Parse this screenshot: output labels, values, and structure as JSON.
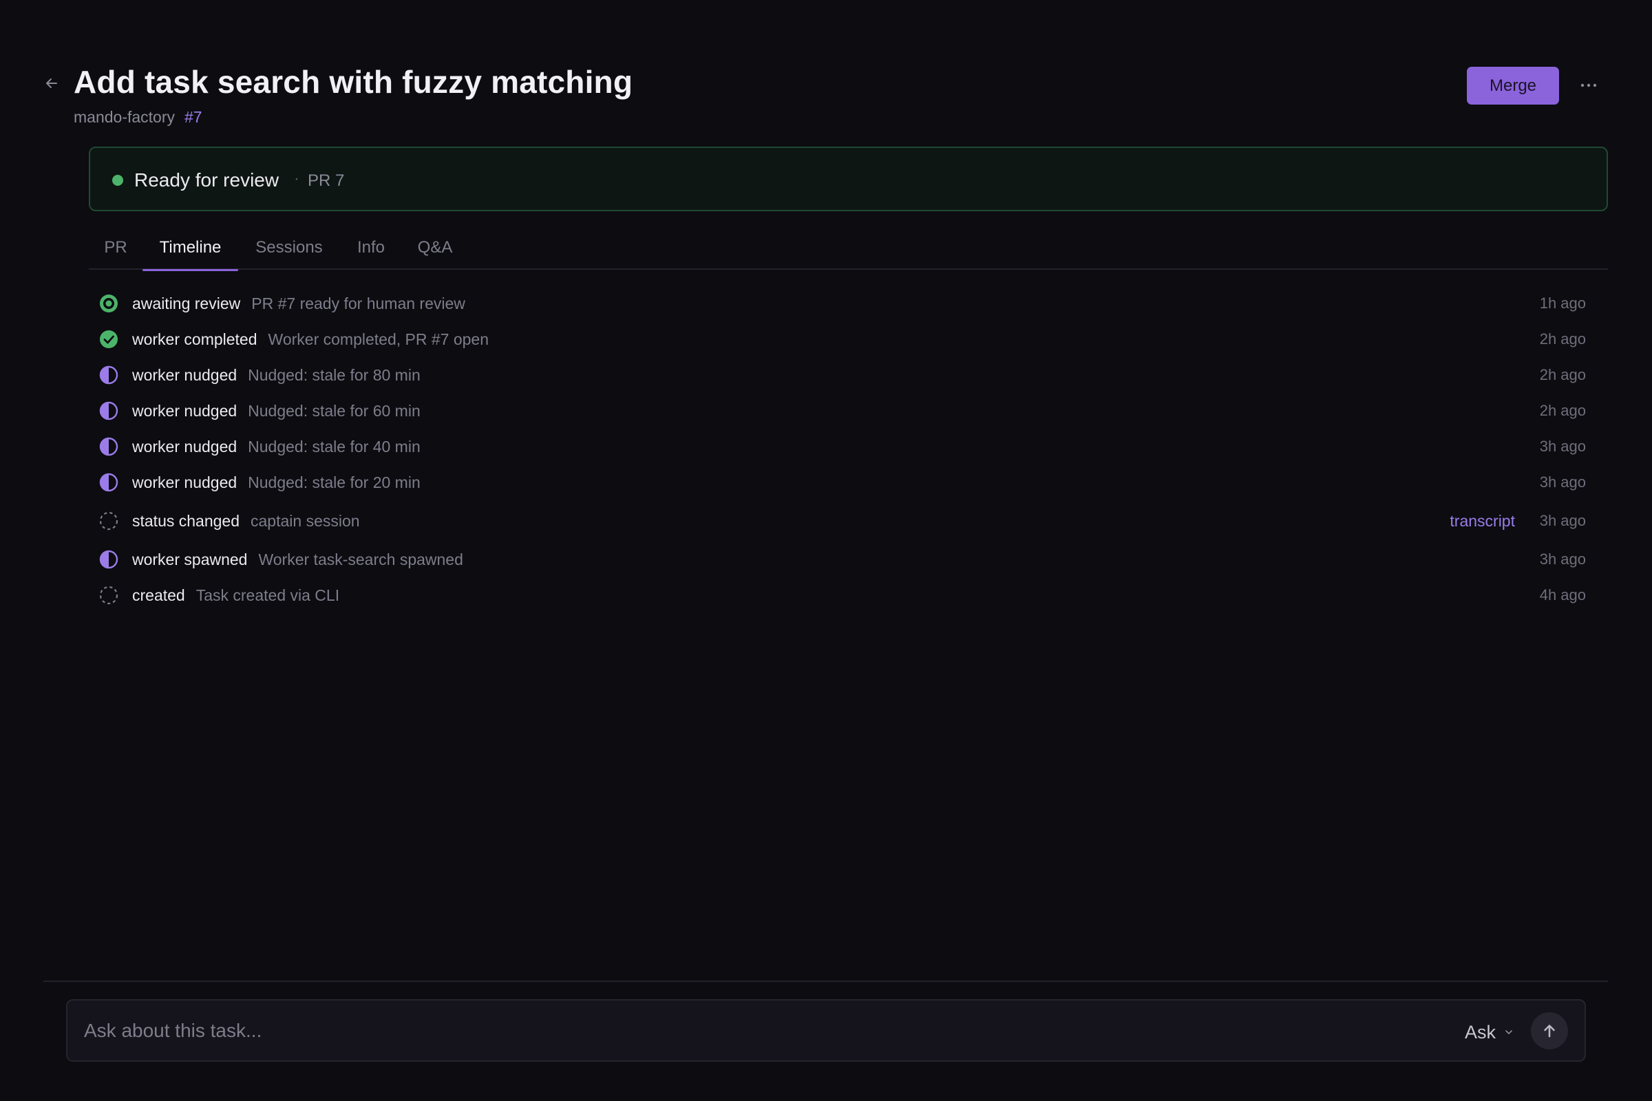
{
  "header": {
    "title": "Add task search with fuzzy matching",
    "repo": "mando-factory",
    "number": "#7",
    "merge_label": "Merge"
  },
  "status_banner": {
    "status": "Ready for review",
    "separator": "·",
    "pr_ref": "PR 7",
    "color": "#4cb46a"
  },
  "tabs": [
    {
      "label": "PR",
      "active": false
    },
    {
      "label": "Timeline",
      "active": true
    },
    {
      "label": "Sessions",
      "active": false
    },
    {
      "label": "Info",
      "active": false
    },
    {
      "label": "Q&A",
      "active": false
    }
  ],
  "timeline": [
    {
      "icon": "status-ring-icon",
      "type": "awaiting review",
      "description": "PR #7 ready for human review",
      "time": "1h ago"
    },
    {
      "icon": "check-circle-icon",
      "type": "worker completed",
      "description": "Worker completed, PR #7 open",
      "time": "2h ago"
    },
    {
      "icon": "half-circle-icon",
      "type": "worker nudged",
      "description": "Nudged: stale for 80 min",
      "time": "2h ago"
    },
    {
      "icon": "half-circle-icon",
      "type": "worker nudged",
      "description": "Nudged: stale for 60 min",
      "time": "2h ago"
    },
    {
      "icon": "half-circle-icon",
      "type": "worker nudged",
      "description": "Nudged: stale for 40 min",
      "time": "3h ago"
    },
    {
      "icon": "half-circle-icon",
      "type": "worker nudged",
      "description": "Nudged: stale for 20 min",
      "time": "3h ago"
    },
    {
      "icon": "dashed-circle-icon",
      "type": "status changed",
      "description": "captain session",
      "link": "transcript",
      "time": "3h ago"
    },
    {
      "icon": "half-circle-icon",
      "type": "worker spawned",
      "description": "Worker task-search spawned",
      "time": "3h ago"
    },
    {
      "icon": "dashed-circle-icon",
      "type": "created",
      "description": "Task created via CLI",
      "time": "4h ago"
    }
  ],
  "ask_bar": {
    "placeholder": "Ask about this task...",
    "mode": "Ask"
  },
  "colors": {
    "accent": "#8b63db",
    "success": "#4cb46a",
    "background": "#0c0c11"
  }
}
